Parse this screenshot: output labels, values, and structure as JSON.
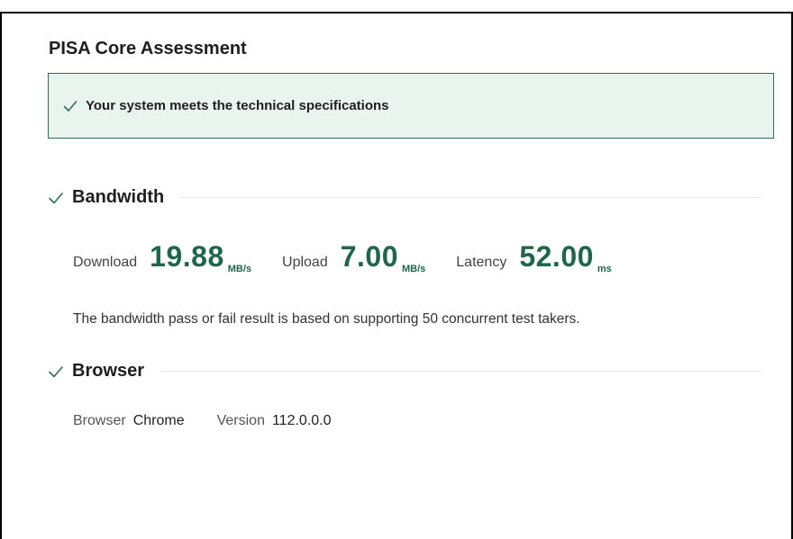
{
  "page": {
    "title": "PISA Core Assessment"
  },
  "banner": {
    "icon": "check-icon",
    "message": "Your system meets the technical specifications",
    "background": "#e9f4ee",
    "border": "#2f6e52"
  },
  "bandwidth": {
    "status_icon": "check-icon",
    "title": "Bandwidth",
    "metrics": [
      {
        "label": "Download",
        "value": "19.88",
        "unit": "MB/s"
      },
      {
        "label": "Upload",
        "value": "7.00",
        "unit": "MB/s"
      },
      {
        "label": "Latency",
        "value": "52.00",
        "unit": "ms"
      }
    ],
    "note": "The bandwidth pass or fail result is based on supporting 50 concurrent test takers."
  },
  "browser": {
    "status_icon": "check-icon",
    "title": "Browser",
    "browser_label": "Browser",
    "browser_value": "Chrome",
    "version_label": "Version",
    "version_value": "112.0.0.0"
  },
  "colors": {
    "accent": "#20664b",
    "check": "#2f6e52"
  }
}
